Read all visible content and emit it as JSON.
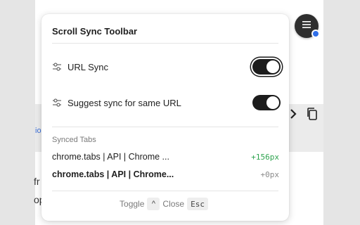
{
  "background": {
    "link_fragment": "io",
    "text_fragment_1": "fr",
    "text_fragment_2": "op"
  },
  "menu_button": {
    "icon": "hamburger-menu-icon",
    "badge_color": "#2f6ee8"
  },
  "panel": {
    "title": "Scroll Sync Toolbar",
    "settings": [
      {
        "label": "URL Sync",
        "icon": "sliders-icon",
        "enabled": true,
        "focused": true
      },
      {
        "label": "Suggest sync for same URL",
        "icon": "sliders-icon",
        "enabled": true,
        "focused": false
      }
    ],
    "synced_tabs_label": "Synced Tabs",
    "synced_tabs": [
      {
        "title": "chrome.tabs | API | Chrome ...",
        "offset": "+156px",
        "offset_color": "#2ea44f",
        "bold": false
      },
      {
        "title": "chrome.tabs | API | Chrome...",
        "offset": "+0px",
        "offset_color": "#8a8a8a",
        "bold": true
      }
    ],
    "footer": {
      "toggle_label": "Toggle",
      "toggle_key": "^",
      "close_label": "Close",
      "close_key": "Esc"
    }
  },
  "colors": {
    "toggle_on": "#1c1c1c",
    "accent": "#2f6ee8"
  }
}
